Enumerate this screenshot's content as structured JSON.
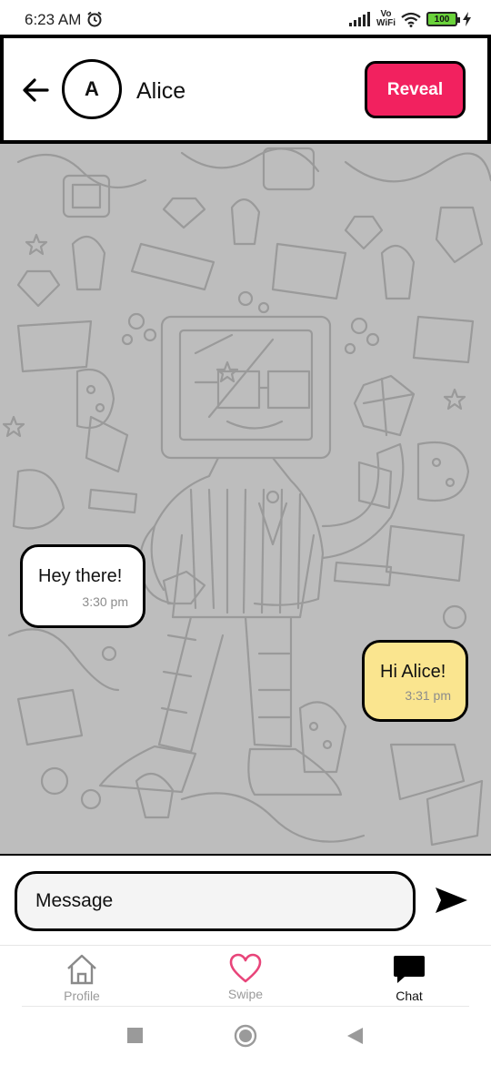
{
  "status_bar": {
    "time": "6:23 AM",
    "network": "Vo WiFi",
    "network_top": "Vo",
    "network_bottom": "WiFi",
    "battery": "100"
  },
  "header": {
    "avatar_initial": "A",
    "contact_name": "Alice",
    "reveal_label": "Reveal"
  },
  "messages": [
    {
      "direction": "incoming",
      "text": "Hey there!",
      "time": "3:30 pm",
      "color": "#ffffff"
    },
    {
      "direction": "outgoing",
      "text": "Hi Alice!",
      "time": "3:31 pm",
      "color": "#fae58f"
    }
  ],
  "composer": {
    "placeholder": "Message"
  },
  "nav": {
    "items": [
      {
        "label": "Profile",
        "icon": "home-icon",
        "active": false
      },
      {
        "label": "Swipe",
        "icon": "heart-icon",
        "active": false
      },
      {
        "label": "Chat",
        "icon": "chat-bubble-icon",
        "active": true
      }
    ]
  },
  "colors": {
    "accent": "#f2215f",
    "outgoing_bubble": "#fae58f",
    "chat_background": "#bdbdbd",
    "heart": "#e8457a"
  }
}
